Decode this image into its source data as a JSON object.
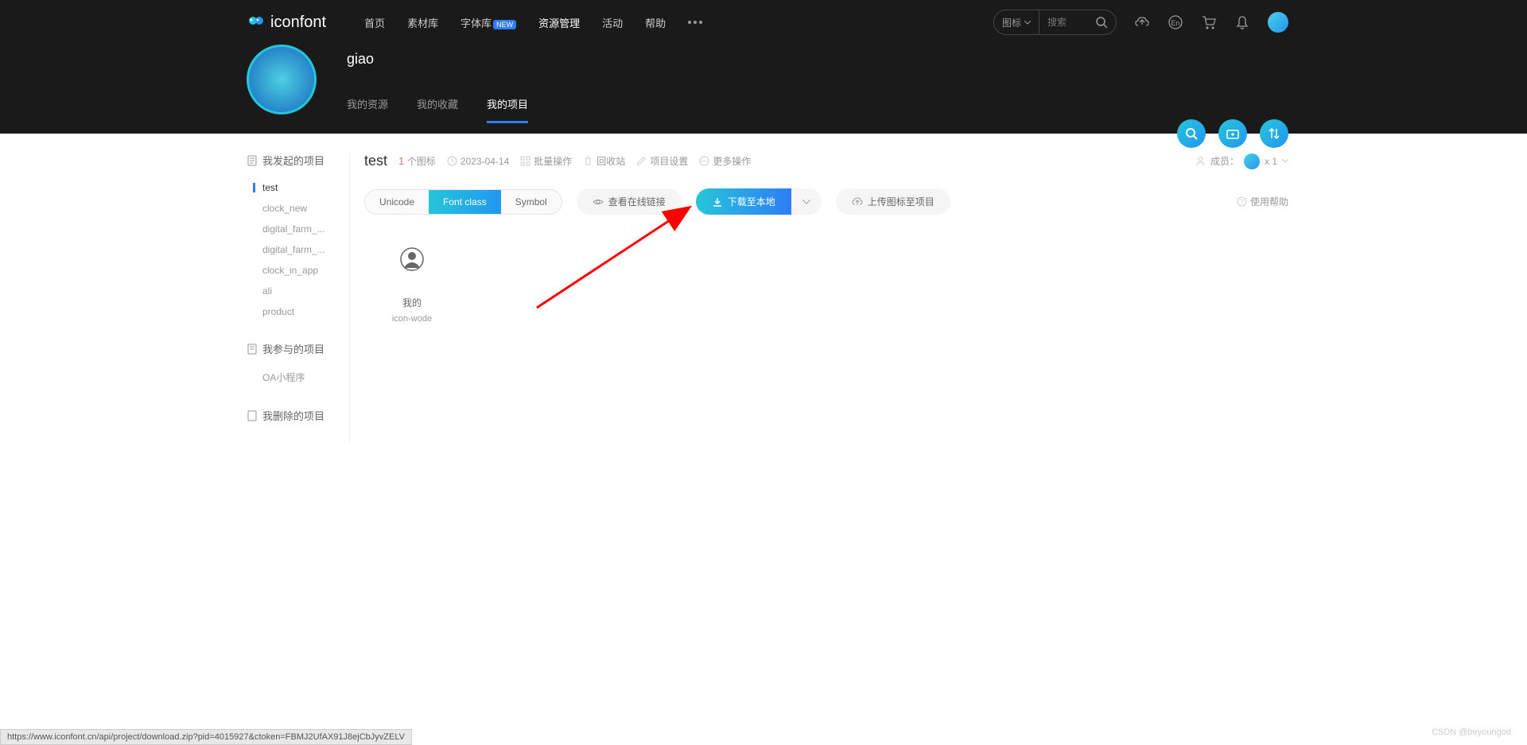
{
  "brand": "iconfont",
  "nav": {
    "items": [
      "首页",
      "素材库",
      "字体库",
      "资源管理",
      "活动",
      "帮助"
    ],
    "new_badge": "NEW",
    "active_index": 3
  },
  "search": {
    "select": "图标",
    "placeholder": "搜索"
  },
  "user": {
    "name": "giao",
    "tabs": [
      "我的资源",
      "我的收藏",
      "我的项目"
    ],
    "active_tab": 2
  },
  "sidebar": {
    "sections": [
      {
        "title": "我发起的项目",
        "items": [
          "test",
          "clock_new",
          "digital_farm_...",
          "digital_farm_...",
          "clock_in_app",
          "ali",
          "product"
        ],
        "active_index": 0
      },
      {
        "title": "我参与的项目",
        "items": [
          "OA小程序"
        ]
      },
      {
        "title": "我删除的项目",
        "items": []
      }
    ]
  },
  "project": {
    "name": "test",
    "icon_count": "1",
    "icon_count_label": "个图标",
    "date": "2023-04-14",
    "actions": {
      "batch": "批量操作",
      "recycle": "回收站",
      "settings": "项目设置",
      "more": "更多操作"
    },
    "members_label": "成员：",
    "members_count": "x 1"
  },
  "toolbar": {
    "segments": [
      "Unicode",
      "Font class",
      "Symbol"
    ],
    "segment_active": 1,
    "view_online": "查看在线链接",
    "download": "下载至本地",
    "upload": "上传图标至项目",
    "help": "使用帮助"
  },
  "icons": [
    {
      "label": "我的",
      "name": "icon-wode"
    }
  ],
  "status_url": "https://www.iconfont.cn/api/project/download.zip?pid=4015927&ctoken=FBMJ2UfAX91J8ejCbJyvZELV",
  "watermark": "CSDN @beyoungod"
}
